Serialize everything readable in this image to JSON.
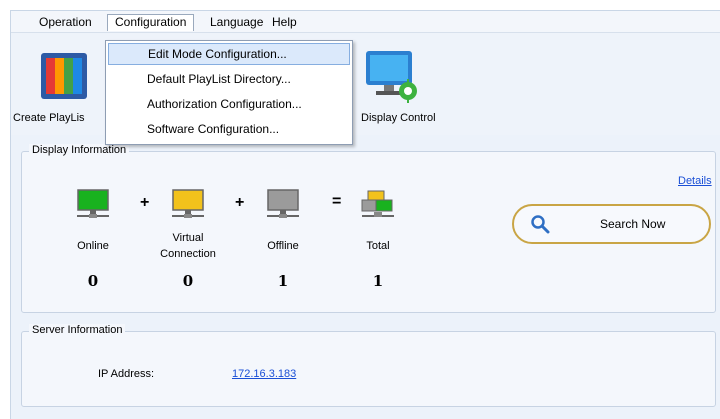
{
  "menu": {
    "items": [
      "Operation",
      "Configuration",
      "Language",
      "Help"
    ]
  },
  "dropdown": {
    "items": [
      "Edit Mode Configuration...",
      "Default PlayList Directory...",
      "Authorization Configuration...",
      "Software Configuration..."
    ]
  },
  "toolbar": {
    "create_playlist": "Create PlayLis",
    "display_control": "Display Control"
  },
  "display_info": {
    "title": "Display Information",
    "details": "Details",
    "online_label": "Online",
    "virtual_label_1": "Virtual",
    "virtual_label_2": "Connection",
    "offline_label": "Offline",
    "total_label": "Total",
    "online_value": "0",
    "virtual_value": "0",
    "offline_value": "1",
    "total_value": "1",
    "plus": "+",
    "equals": "=",
    "search_label": "Search Now"
  },
  "server_info": {
    "title": "Server Information",
    "ip_label": "IP Address:",
    "ip_value": "172.16.3.183"
  },
  "colors": {
    "online": "#19b21f",
    "virtual": "#f2c21c",
    "offline": "#9b9b9b",
    "link": "#1a4fd6",
    "search_border": "#c9a545"
  }
}
